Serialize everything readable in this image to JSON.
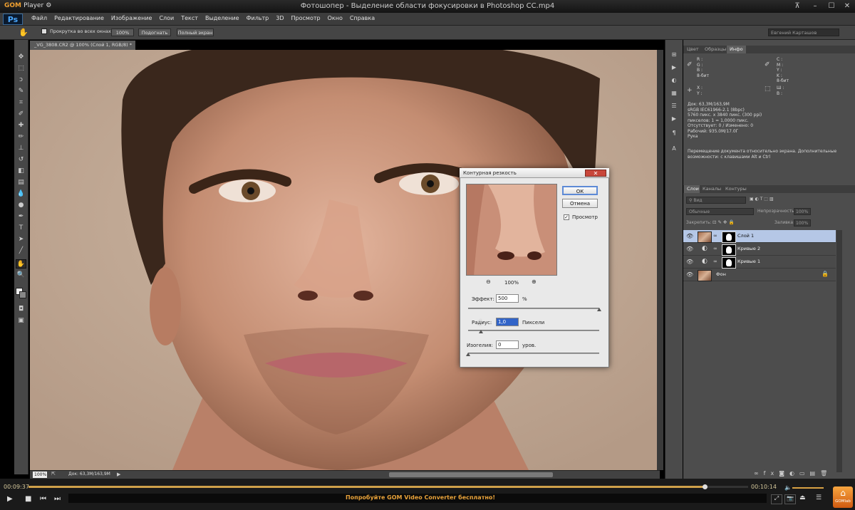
{
  "player": {
    "logo_brand": "GOM",
    "logo_suffix": "Player",
    "title": "Фотошопер - Выделение области фокусировки в Photoshop CC.mp4",
    "time_current": "00:09:37",
    "time_total": "00:10:14",
    "progress_percent": 94,
    "promo": "Попробуйте GOM Video Converter бесплатно!",
    "home_label": "GOMlab"
  },
  "photoshop": {
    "logo": "Ps",
    "menu": [
      "Файл",
      "Редактирование",
      "Изображение",
      "Слои",
      "Текст",
      "Выделение",
      "Фильтр",
      "3D",
      "Просмотр",
      "Окно",
      "Справка"
    ],
    "options": {
      "scroll_all_label": "Прокрутка во всех окнах",
      "zoom_100": "100%",
      "fit": "Подогнать",
      "fullscreen": "Полный экран",
      "user": "Евгений Карташов"
    },
    "doc_tab": "_VG_3808.CR2 @ 100% (Слой 1, RGB/8) *",
    "status_zoom": "100%",
    "status_doc": "Док: 63,3M/163,9M",
    "info_panel": {
      "tabs": [
        "Цвет",
        "Образцы",
        "Инфо"
      ],
      "rgb_left": [
        "R :",
        "G :",
        "B :"
      ],
      "cmyk_right": [
        "C :",
        "M :",
        "Y :",
        "K :"
      ],
      "bits_left": "8-бит",
      "bits_right": "8-бит",
      "xy_left": [
        "X :",
        "Y :"
      ],
      "wh_right": [
        "Ш :",
        "В :"
      ],
      "doc_info": [
        "Док: 63,3M/163,9M",
        "sRGB IEC61966-2.1 (8bpc)",
        "5760 пикс. x 3840 пикс. (300 ppi)",
        "пикселов: 1 = 1,0000 пикс.",
        "Отсутствует: 0 / Изменено: 0",
        "Рабочий: 935.0M/17.0Г",
        "Рука"
      ],
      "hint": "Перемещение документа относительно экрана. Дополнительные возможности: с клавишами Alt и Ctrl"
    },
    "layers_panel": {
      "tabs": [
        "Слои",
        "Каналы",
        "Контуры"
      ],
      "filter": "Вид",
      "blend_mode": "Обычные",
      "opacity_label": "Непрозрачность:",
      "opacity": "100%",
      "lock_label": "Закрепить:",
      "fill_label": "Заливка:",
      "fill": "100%",
      "layers": [
        {
          "name": "Слой 1",
          "selected": true
        },
        {
          "name": "Кривые 2",
          "selected": false
        },
        {
          "name": "Кривые 1",
          "selected": false
        },
        {
          "name": "Фон",
          "selected": false
        }
      ]
    },
    "dialog": {
      "title": "Контурная резкость",
      "ok": "ОК",
      "cancel": "Отмена",
      "preview_label": "Просмотр",
      "preview_zoom": "100%",
      "amount_label": "Эффект:",
      "amount_value": "500",
      "amount_unit": "%",
      "radius_label": "Радиус:",
      "radius_value": "1,0",
      "radius_unit": "Пиксели",
      "threshold_label": "Изогелия:",
      "threshold_value": "0",
      "threshold_unit": "уров.",
      "amount_slider_fraction": 1.0,
      "radius_slider_fraction": 0.1,
      "threshold_slider_fraction": 0.0
    }
  },
  "colors": {
    "accent_gom": "#e8a23a",
    "ps_panel": "#4d4d4d",
    "selected_layer": "#b5c7e6"
  }
}
